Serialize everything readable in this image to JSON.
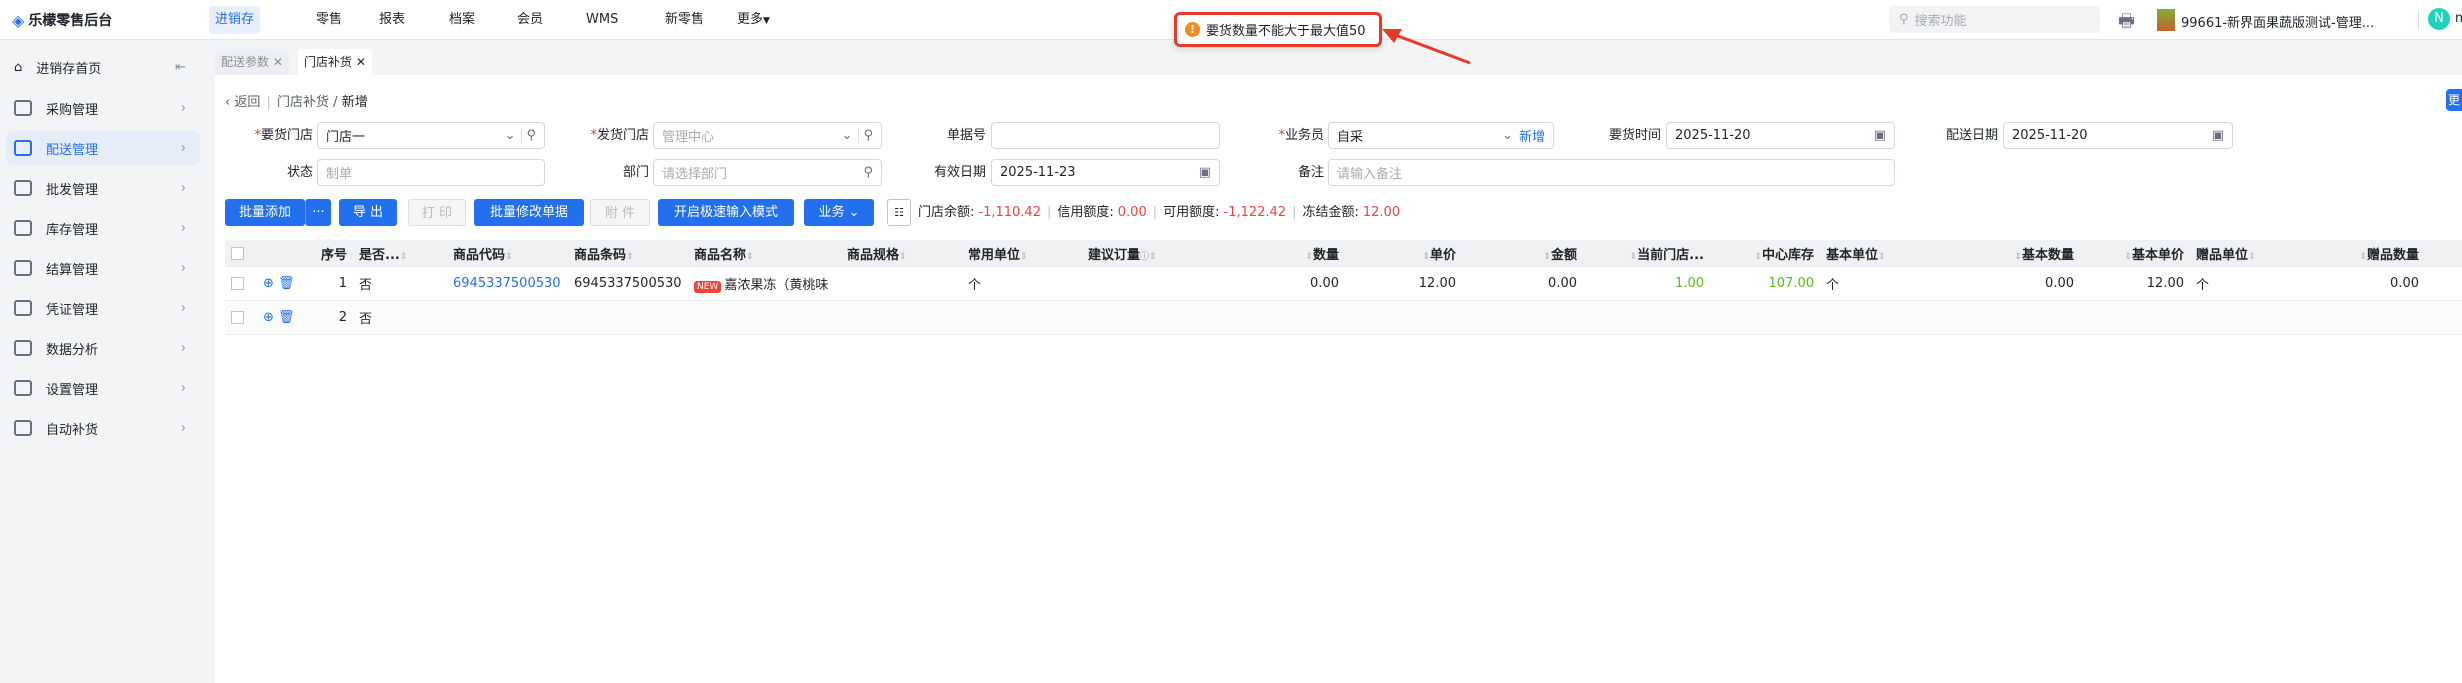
{
  "app": {
    "title": "乐檬零售后台"
  },
  "nav": [
    "进销存",
    "零售",
    "报表",
    "档案",
    "会员",
    "WMS",
    "新零售",
    "更多"
  ],
  "toast": {
    "message": "要货数量不能大于最大值50"
  },
  "header": {
    "search_placeholder": "搜索功能",
    "store": "99661-新界面果蔬版测试-管理...",
    "avatar": "N",
    "user": "m"
  },
  "sidebar": {
    "home": "进销存首页",
    "items": [
      "采购管理",
      "配送管理",
      "批发管理",
      "库存管理",
      "结算管理",
      "凭证管理",
      "数据分析",
      "设置管理",
      "自动补货"
    ]
  },
  "tabs": [
    "配送参数",
    "门店补货"
  ],
  "breadcrumb": {
    "back": "返回",
    "parent": "门店补货",
    "current": "新增"
  },
  "side_button": "更",
  "form": {
    "req_store_label": "要货门店",
    "req_store": "门店一",
    "ship_store_label": "发货门店",
    "ship_store_ph": "管理中心",
    "doc_no_label": "单据号",
    "salesman_label": "业务员",
    "salesman": "自采",
    "salesman_add": "新增",
    "req_time_label": "要货时间",
    "req_time": "2025-11-20",
    "ship_date_label": "配送日期",
    "ship_date": "2025-11-20",
    "status_label": "状态",
    "status_ph": "制单",
    "dept_label": "部门",
    "dept_ph": "请选择部门",
    "valid_label": "有效日期",
    "valid_date": "2025-11-23",
    "remark_label": "备注",
    "remark_ph": "请输入备注"
  },
  "toolbar": {
    "batch_add": "批量添加",
    "more": "···",
    "export": "导 出",
    "print": "打 印",
    "batch_edit": "批量修改单据",
    "attach": "附 件",
    "fast_input": "开启极速输入模式",
    "business": "业务"
  },
  "info": {
    "balance_label": "门店余额:",
    "balance": "-1,110.42",
    "credit_label": "信用额度:",
    "credit": "0.00",
    "avail_label": "可用额度:",
    "avail": "-1,122.42",
    "frozen_label": "冻结金额:",
    "frozen": "12.00"
  },
  "table": {
    "columns": [
      "",
      "",
      "序号",
      "是否...",
      "商品代码",
      "商品条码",
      "商品名称",
      "商品规格",
      "常用单位",
      "建议订量",
      "数量",
      "单价",
      "金额",
      "当前门店...",
      "中心库存",
      "基本单位",
      "基本数量",
      "基本单价",
      "赠品单位",
      "赠品数量"
    ],
    "rows": [
      [
        "",
        "",
        "1",
        "否",
        "6945337500530",
        "6945337500530",
        "嘉浓果冻（黄桃味",
        "",
        "个",
        "",
        "0.00",
        "12.00",
        "0.00",
        "1.00",
        "107.00",
        "个",
        "0.00",
        "12.00",
        "个",
        "0.00"
      ],
      [
        "",
        "",
        "2",
        "否",
        "",
        "",
        "",
        "",
        "",
        "",
        "",
        "",
        "",
        "",
        "",
        "",
        "",
        "",
        "",
        ""
      ]
    ],
    "new_badge": "NEW"
  }
}
